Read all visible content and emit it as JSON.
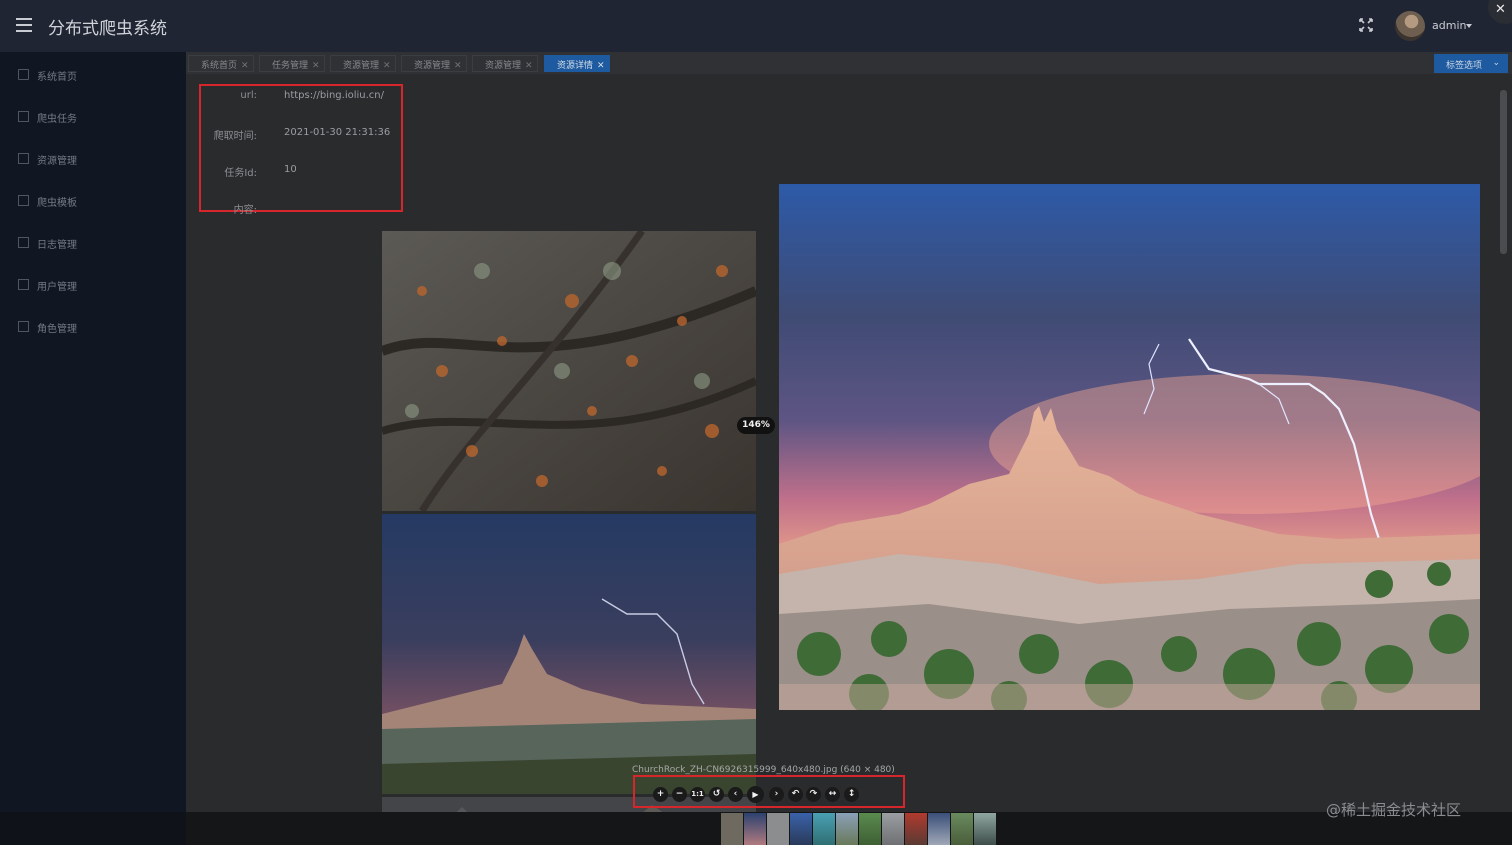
{
  "header": {
    "app_title": "分布式爬虫系统",
    "user_name": "admin"
  },
  "sidebar": {
    "items": [
      {
        "label": "系统首页",
        "icon": "home-icon"
      },
      {
        "label": "爬虫任务",
        "icon": "grid-icon"
      },
      {
        "label": "资源管理",
        "icon": "grid-icon"
      },
      {
        "label": "爬虫模板",
        "icon": "grid-icon"
      },
      {
        "label": "日志管理",
        "icon": "grid-icon"
      },
      {
        "label": "用户管理",
        "icon": "grid-icon"
      },
      {
        "label": "角色管理",
        "icon": "grid-icon"
      }
    ]
  },
  "tabs": [
    {
      "label": "系统首页",
      "active": false
    },
    {
      "label": "任务管理",
      "active": false
    },
    {
      "label": "资源管理",
      "active": false
    },
    {
      "label": "资源管理",
      "active": false
    },
    {
      "label": "资源管理",
      "active": false
    },
    {
      "label": "资源详情",
      "active": true
    }
  ],
  "tab_options_label": "标签选项",
  "detail": {
    "url_label": "url:",
    "url_value": "https://bing.ioliu.cn/",
    "time_label": "爬取时间:",
    "time_value": "2021-01-30 21:31:36",
    "task_label": "任务Id:",
    "task_value": "10",
    "content_label": "内容:"
  },
  "viewer": {
    "zoom_label": "146%",
    "caption": "ChurchRock_ZH-CN6926315999_640x480.jpg (640 × 480)",
    "tools": [
      {
        "symbol": "+",
        "icon": "zoom-in-icon"
      },
      {
        "symbol": "−",
        "icon": "zoom-out-icon"
      },
      {
        "symbol": "1:1",
        "icon": "one-to-one-icon"
      },
      {
        "symbol": "↺",
        "icon": "reset-icon"
      },
      {
        "symbol": "‹",
        "icon": "prev-icon"
      },
      {
        "symbol": "▶",
        "icon": "play-icon"
      },
      {
        "symbol": "›",
        "icon": "next-icon"
      },
      {
        "symbol": "↶",
        "icon": "rotate-left-icon"
      },
      {
        "symbol": "↷",
        "icon": "rotate-right-icon"
      },
      {
        "symbol": "↔",
        "icon": "flip-horizontal-icon"
      },
      {
        "symbol": "↕",
        "icon": "flip-vertical-icon"
      }
    ]
  },
  "watermark": "@稀土掘金技术社区",
  "colors": {
    "header_bg": "#1f2533",
    "sidebar_bg": "#111722",
    "active_tab": "#1e5a9f",
    "highlight_border": "#d6262b"
  }
}
